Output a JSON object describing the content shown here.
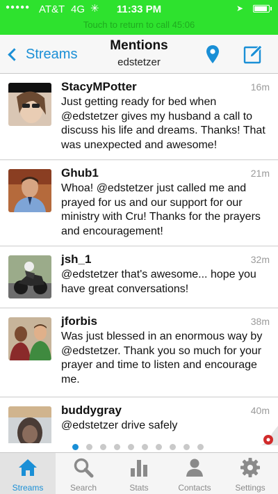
{
  "status_bar": {
    "carrier": "AT&T",
    "network": "4G",
    "time": "11:33 PM",
    "call_banner": "Touch to return to call 45:06",
    "battery_level": 0.9
  },
  "nav": {
    "back_label": "Streams",
    "title": "Mentions",
    "subtitle": "edstetzer"
  },
  "tweets": [
    {
      "user": "StacyMPotter",
      "time": "16m",
      "text": "Just getting ready for bed when @edstetzer gives my husband a call to discuss his life and dreams. Thanks! That was unexpected and awesome!"
    },
    {
      "user": "Ghub1",
      "time": "21m",
      "text": "Whoa! @edstetzer just called me and prayed for us and our support for our ministry with Cru! Thanks for the prayers and encouragement!"
    },
    {
      "user": "jsh_1",
      "time": "32m",
      "text": "@edstetzer that's awesome... hope you have great conversations!"
    },
    {
      "user": "jforbis",
      "time": "38m",
      "text": "Was just blessed in an enormous way by @edstetzer. Thank you so much for your prayer and time to listen and encourage me."
    },
    {
      "user": "buddygray",
      "time": "40m",
      "text": "@edstetzer drive safely"
    }
  ],
  "pagination": {
    "current": 1,
    "total": 10
  },
  "tabs": [
    {
      "label": "Streams",
      "icon": "home-icon",
      "active": true
    },
    {
      "label": "Search",
      "icon": "search-icon",
      "active": false
    },
    {
      "label": "Stats",
      "icon": "stats-icon",
      "active": false
    },
    {
      "label": "Contacts",
      "icon": "contacts-icon",
      "active": false
    },
    {
      "label": "Settings",
      "icon": "gear-icon",
      "active": false
    }
  ],
  "colors": {
    "status_bar": "#2ee22e",
    "accent": "#1a8fd6",
    "tab_inactive": "#8a8a8a"
  }
}
